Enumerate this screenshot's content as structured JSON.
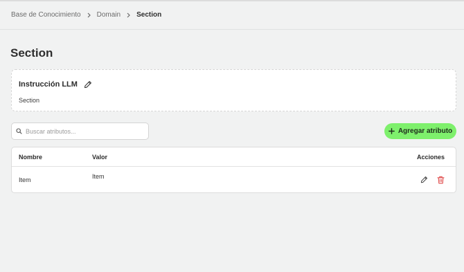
{
  "breadcrumb": {
    "items": [
      "Base de Conocimiento",
      "Domain",
      "Section"
    ]
  },
  "page": {
    "title": "Section"
  },
  "llm": {
    "title": "Instrucción LLM",
    "value": "Section"
  },
  "search": {
    "placeholder": "Buscar atributos..."
  },
  "add_button": {
    "label": "Agregar atributo"
  },
  "table": {
    "headers": {
      "name": "Nombre",
      "value": "Valor",
      "actions": "Acciones"
    },
    "rows": [
      {
        "name": "Item",
        "value": "Item"
      }
    ]
  },
  "colors": {
    "accent": "#7ef06c",
    "delete": "#e04b4b",
    "background": "#f1f2f2"
  }
}
